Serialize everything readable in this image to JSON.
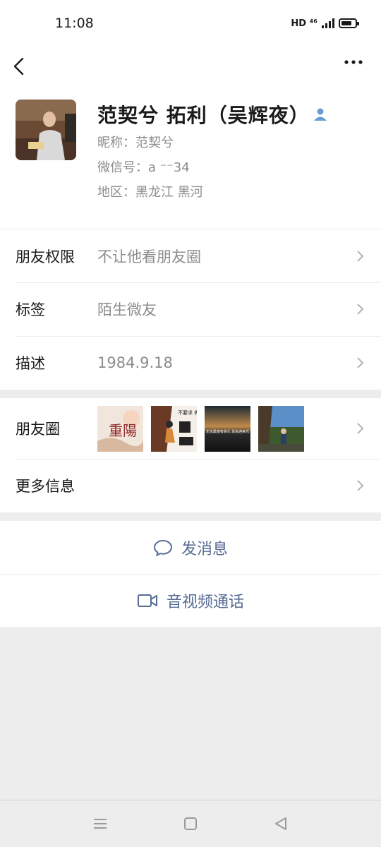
{
  "status_bar": {
    "time": "11:08",
    "network": "HD ⁴⁶"
  },
  "profile": {
    "name": "范契兮 拓利（吴辉夜）",
    "nickname_line": "昵称：范契兮",
    "wechat_id_line": "微信号：a     ⁻⁻34",
    "region_line": "地区：黑龙江  黑河"
  },
  "settings": [
    {
      "label": "朋友权限",
      "value": "不让他看朋友圈"
    },
    {
      "label": "标签",
      "value": "陌生微友"
    },
    {
      "label": "描述",
      "value": "1984.9.18"
    }
  ],
  "moments": {
    "label": "朋友圈",
    "thumbnails": [
      {
        "caption": "重陽"
      },
      {
        "caption": "不要求 做自己 人生"
      },
      {
        "caption": "无论黑暗有多久 总会迎来光"
      },
      {
        "caption": ""
      }
    ]
  },
  "more_info": {
    "label": "更多信息"
  },
  "actions": {
    "message": "发消息",
    "video_call": "音视频通话"
  },
  "colors": {
    "link_blue": "#576b95",
    "background": "#ededed",
    "secondary_text": "#8c8c8c"
  }
}
